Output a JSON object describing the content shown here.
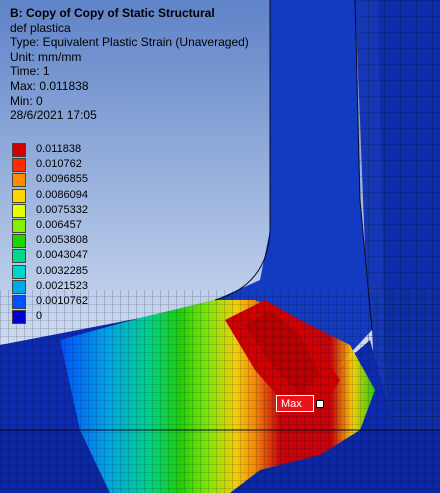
{
  "header": {
    "title": "B: Copy of Copy of Static Structural",
    "subtitle": "def plastica",
    "type": "Type: Equivalent Plastic Strain (Unaveraged)",
    "unit": "Unit: mm/mm",
    "time": "Time: 1",
    "max": "Max: 0.011838",
    "min": "Min: 0",
    "date": "28/6/2021 17:05"
  },
  "legend": {
    "items": [
      {
        "label": "0.011838",
        "color": "#d10000"
      },
      {
        "label": "0.010762",
        "color": "#ff2a00"
      },
      {
        "label": "0.0096855",
        "color": "#ff8a00"
      },
      {
        "label": "0.0086094",
        "color": "#ffd500"
      },
      {
        "label": "0.0075332",
        "color": "#e6ff00"
      },
      {
        "label": "0.006457",
        "color": "#86f000"
      },
      {
        "label": "0.0053808",
        "color": "#1fd600"
      },
      {
        "label": "0.0043047",
        "color": "#00d98a"
      },
      {
        "label": "0.0032285",
        "color": "#00d6c8"
      },
      {
        "label": "0.0021523",
        "color": "#00a8e8"
      },
      {
        "label": "0.0010762",
        "color": "#0052ff"
      },
      {
        "label": "0",
        "color": "#0000d0"
      }
    ]
  },
  "probe": {
    "label": "Max"
  }
}
